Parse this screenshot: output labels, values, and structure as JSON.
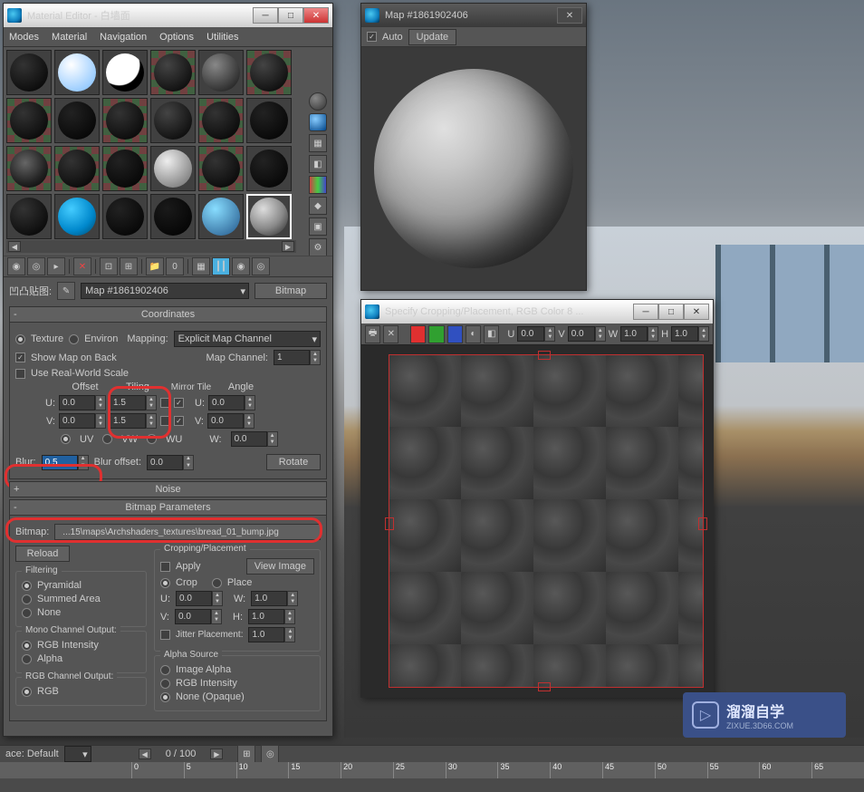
{
  "mat_editor": {
    "title": "Material Editor - 白墙面",
    "menu": [
      "Modes",
      "Material",
      "Navigation",
      "Options",
      "Utilities"
    ],
    "slot_label": "凹凸贴图:",
    "slot_name": "Map #1861902406",
    "slot_type": "Bitmap",
    "rollouts": {
      "coordinates": {
        "title": "Coordinates",
        "texture": "Texture",
        "environ": "Environ",
        "mapping_lbl": "Mapping:",
        "mapping_val": "Explicit Map Channel",
        "show_map": "Show Map on Back",
        "map_channel_lbl": "Map Channel:",
        "map_channel_val": "1",
        "real_world": "Use Real-World Scale",
        "hdr_offset": "Offset",
        "hdr_tiling": "Tiling",
        "hdr_mirror": "Mirror Tile",
        "hdr_angle": "Angle",
        "u": "U:",
        "v": "V:",
        "w": "W:",
        "u_off": "0.0",
        "v_off": "0.0",
        "u_til": "1.5",
        "v_til": "1.5",
        "u_ang": "0.0",
        "v_ang": "0.0",
        "w_ang": "0.0",
        "uv": "UV",
        "vw": "VW",
        "wu": "WU",
        "blur_lbl": "Blur:",
        "blur_val": "0.5",
        "blur_off_lbl": "Blur offset:",
        "blur_off_val": "0.0",
        "rotate": "Rotate"
      },
      "noise": {
        "title": "Noise"
      },
      "bitmap": {
        "title": "Bitmap Parameters",
        "bitmap_lbl": "Bitmap:",
        "bitmap_path": "...15\\maps\\Archshaders_textures\\bread_01_bump.jpg",
        "reload": "Reload",
        "crop_title": "Cropping/Placement",
        "apply": "Apply",
        "view_img": "View Image",
        "crop": "Crop",
        "place": "Place",
        "cu": "U:",
        "cv": "V:",
        "cw": "W:",
        "ch": "H:",
        "cu_v": "0.0",
        "cv_v": "0.0",
        "cw_v": "1.0",
        "ch_v": "1.0",
        "jitter": "Jitter Placement:",
        "jitter_v": "1.0",
        "filter_title": "Filtering",
        "pyr": "Pyramidal",
        "sum": "Summed Area",
        "none": "None",
        "mono_title": "Mono Channel Output:",
        "rgb_int": "RGB Intensity",
        "alpha": "Alpha",
        "rgb_title": "RGB Channel Output:",
        "rgb": "RGB",
        "alpha_src": "Alpha Source",
        "img_alpha": "Image Alpha",
        "none_opq": "None (Opaque)"
      }
    }
  },
  "map_preview": {
    "title": "Map #1861902406",
    "auto": "Auto",
    "update": "Update"
  },
  "crop_window": {
    "title": "Specify Cropping/Placement, RGB Color 8 ...",
    "u": "U",
    "v": "V",
    "w": "W",
    "h": "H",
    "u_v": "0.0",
    "v_v": "0.0",
    "w_v": "1.0",
    "h_v": "1.0"
  },
  "timeline": {
    "space": "ace: Default",
    "frame": "0 / 100",
    "ticks": [
      "0",
      "5",
      "10",
      "15",
      "20",
      "25",
      "30",
      "35",
      "40",
      "45",
      "50",
      "55",
      "60",
      "65"
    ]
  },
  "watermark": {
    "main": "溜溜自学",
    "sub": "ZIXUE.3D66.COM"
  }
}
